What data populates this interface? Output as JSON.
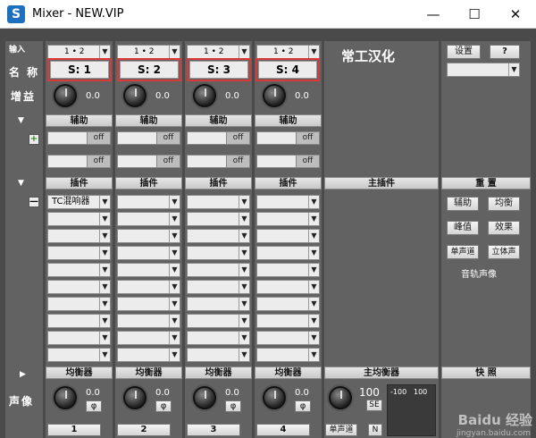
{
  "window": {
    "title": "Mixer - NEW.VIP",
    "app_icon": "S",
    "minimize": "—",
    "maximize": "☐",
    "close": "✕"
  },
  "rows": {
    "input": "输入",
    "name": "名 称",
    "gain": "增益",
    "pan": "声像"
  },
  "channels": [
    {
      "input": "1 • 2",
      "name": "S: 1",
      "gain": "0.0",
      "pan": "0.0",
      "number": "1"
    },
    {
      "input": "1 • 2",
      "name": "S: 2",
      "gain": "0.0",
      "pan": "0.0",
      "number": "2"
    },
    {
      "input": "1 • 2",
      "name": "S: 3",
      "gain": "0.0",
      "pan": "0.0",
      "number": "3"
    },
    {
      "input": "1 • 2",
      "name": "S: 4",
      "gain": "0.0",
      "pan": "0.0",
      "number": "4"
    }
  ],
  "master": {
    "title": "常工汉化",
    "plugin_header": "主插件",
    "eq_header": "主均衡器",
    "value": "100",
    "se": "SE",
    "mono": "单声道",
    "n": "N",
    "scale_left": "-100",
    "scale_right": "100"
  },
  "aux": {
    "header": "辅助",
    "off": "off",
    "add": "+"
  },
  "plugin": {
    "header": "插件",
    "first_slot": "TC混响器",
    "remove": "—"
  },
  "eq": {
    "header": "均衡器",
    "phase": "φ"
  },
  "right": {
    "settings": "设置",
    "help": "?",
    "reset_header": "重 置",
    "aux": "辅助",
    "eq": "均衡",
    "peak": "峰值",
    "effect": "效果",
    "mono": "单声道",
    "stereo": "立体声",
    "pan_image": "音轨声像",
    "snapshot": "快 照"
  },
  "watermark": {
    "brand": "Baidu 经验",
    "url": "jingyan.baidu.com"
  }
}
